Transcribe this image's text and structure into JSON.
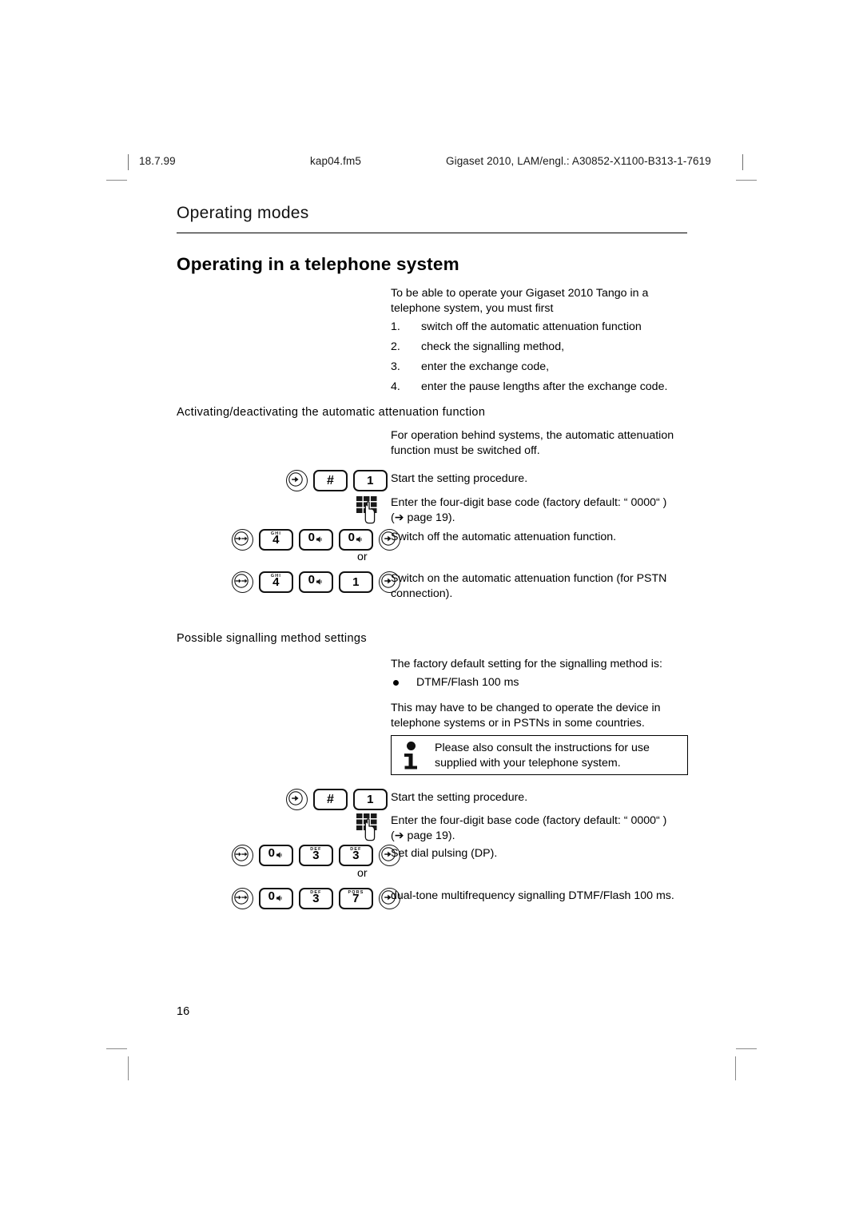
{
  "running_header": {
    "date": "18.7.99",
    "filename": "kap04.fm5",
    "identifier": "Gigaset 2010, LAM/engl.: A30852-X1100-B313-1-7619"
  },
  "chapter_title": "Operating modes",
  "section_title": "Operating in a telephone system",
  "intro": "To be able to operate your Gigaset 2010 Tango in a telephone system, you must first",
  "numbered_steps": [
    {
      "num": "1.",
      "text": "switch off the automatic attenuation function"
    },
    {
      "num": "2.",
      "text": "check the signalling method,"
    },
    {
      "num": "3.",
      "text": "enter the exchange code,"
    },
    {
      "num": "4.",
      "text": "enter the pause lengths after the exchange code."
    }
  ],
  "subhead_attenuation": "Activating/deactivating the automatic attenuation function",
  "attenuation_intro": "For operation behind systems, the automatic attenuation function must be switched off.",
  "procedure_one": {
    "start_text": "Start the setting procedure.",
    "base_code_text": "Enter the four-digit base code (factory default: “ 0000“ )",
    "base_code_ref": "(➔ page 19).",
    "switch_off_text": "Switch off the automatic attenuation function.",
    "or_label": "or",
    "switch_on_text": "Switch on the automatic attenuation function (for PSTN connection).",
    "keys_start": [
      {
        "type": "round",
        "icon": "set-key-icon",
        "label": "set"
      },
      {
        "type": "rect",
        "icon": "hash-key-icon",
        "label": "#"
      },
      {
        "type": "rect",
        "icon": "digit-key-icon",
        "label": "1",
        "letters": ""
      }
    ],
    "keys_keypad": {
      "type": "keypad-hand",
      "icon": "keypad-hand-icon",
      "label": "keypad entry"
    },
    "keys_switch_off": [
      {
        "type": "round",
        "icon": "double-arrow-key-icon",
        "label": "→→"
      },
      {
        "type": "rect",
        "icon": "digit-key-icon",
        "label": "4",
        "letters": "GHI"
      },
      {
        "type": "rect",
        "icon": "zero-key-icon",
        "label": "0",
        "letters": ""
      },
      {
        "type": "rect",
        "icon": "zero-key-icon",
        "label": "0",
        "letters": ""
      },
      {
        "type": "round",
        "icon": "set-key-icon",
        "label": "set"
      }
    ],
    "keys_switch_on": [
      {
        "type": "round",
        "icon": "double-arrow-key-icon",
        "label": "→→"
      },
      {
        "type": "rect",
        "icon": "digit-key-icon",
        "label": "4",
        "letters": "GHI"
      },
      {
        "type": "rect",
        "icon": "zero-key-icon",
        "label": "0",
        "letters": ""
      },
      {
        "type": "rect",
        "icon": "digit-key-icon",
        "label": "1",
        "letters": ""
      },
      {
        "type": "round",
        "icon": "set-key-icon",
        "label": "set"
      }
    ]
  },
  "subhead_signalling": "Possible signalling method settings",
  "signalling": {
    "default_intro": "The factory default setting for the signalling method is:",
    "default_value": "DTMF/Flash 100 ms",
    "change_note": "This may have to be changed to operate the device in telephone systems or in PSTNs in some countries."
  },
  "note": {
    "icon": "info-icon",
    "text": "Please also consult the instructions for use supplied with your telephone system."
  },
  "procedure_two": {
    "start_text": "Start the setting procedure.",
    "base_code_text": "Enter the four-digit base code (factory default: “ 0000“ )",
    "base_code_ref": "(➔ page 19).",
    "dial_pulsing_text": "Set dial pulsing (DP).",
    "or_label": "or",
    "dtmf_text": "dual-tone multifrequency signalling DTMF/Flash 100 ms.",
    "keys_start": [
      {
        "type": "round",
        "icon": "set-key-icon",
        "label": "set"
      },
      {
        "type": "rect",
        "icon": "hash-key-icon",
        "label": "#"
      },
      {
        "type": "rect",
        "icon": "digit-key-icon",
        "label": "1",
        "letters": ""
      }
    ],
    "keys_keypad": {
      "type": "keypad-hand",
      "icon": "keypad-hand-icon",
      "label": "keypad entry"
    },
    "keys_dial_pulsing": [
      {
        "type": "round",
        "icon": "double-arrow-key-icon",
        "label": "→→"
      },
      {
        "type": "rect",
        "icon": "zero-key-icon",
        "label": "0",
        "letters": ""
      },
      {
        "type": "rect",
        "icon": "digit-key-icon",
        "label": "3",
        "letters": "DEF"
      },
      {
        "type": "rect",
        "icon": "digit-key-icon",
        "label": "3",
        "letters": "DEF"
      },
      {
        "type": "round",
        "icon": "set-key-icon",
        "label": "set"
      }
    ],
    "keys_dtmf": [
      {
        "type": "round",
        "icon": "double-arrow-key-icon",
        "label": "→→"
      },
      {
        "type": "rect",
        "icon": "zero-key-icon",
        "label": "0",
        "letters": ""
      },
      {
        "type": "rect",
        "icon": "digit-key-icon",
        "label": "3",
        "letters": "DEF"
      },
      {
        "type": "rect",
        "icon": "digit-key-icon",
        "label": "7",
        "letters": "PQRS"
      },
      {
        "type": "round",
        "icon": "set-key-icon",
        "label": "set"
      }
    ]
  },
  "page_number": "16",
  "colors": {
    "text": "#000000",
    "rule": "#000000",
    "crop_mark": "#8a8a8a"
  }
}
